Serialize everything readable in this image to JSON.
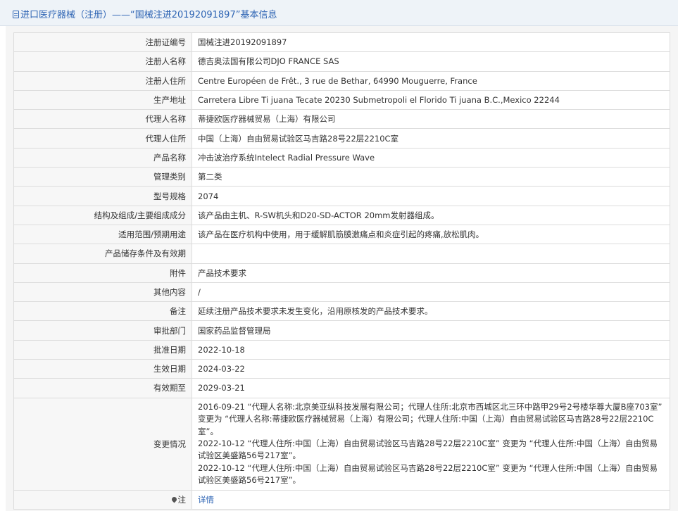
{
  "header": {
    "title": "进口医疗器械（注册）——“国械注进20192091897”基本信息"
  },
  "rows": [
    {
      "label": "注册证编号",
      "value": "国械注进20192091897"
    },
    {
      "label": "注册人名称",
      "value": "德吉奥法国有限公司DJO FRANCE SAS"
    },
    {
      "label": "注册人住所",
      "value": "Centre Européen de Frêt., 3 rue de Bethar, 64990 Mouguerre, France"
    },
    {
      "label": "生产地址",
      "value": "Carretera Libre Ti juana Tecate 20230 Submetropoli el Florido Ti juana B.C.,Mexico 22244"
    },
    {
      "label": "代理人名称",
      "value": "蒂捷欧医疗器械贸易（上海）有限公司"
    },
    {
      "label": "代理人住所",
      "value": "中国（上海）自由贸易试验区马吉路28号22层2210C室"
    },
    {
      "label": "产品名称",
      "value": "冲击波治疗系统Intelect Radial Pressure Wave"
    },
    {
      "label": "管理类别",
      "value": "第二类"
    },
    {
      "label": "型号规格",
      "value": "2074"
    },
    {
      "label": "结构及组成/主要组成成分",
      "value": "该产品由主机、R-SW机头和D20-SD-ACTOR 20mm发射器组成。"
    },
    {
      "label": "适用范围/预期用途",
      "value": "该产品在医疗机构中使用，用于缓解肌筋膜激痛点和炎症引起的疼痛,放松肌肉。"
    },
    {
      "label": "产品储存条件及有效期",
      "value": ""
    },
    {
      "label": "附件",
      "value": "产品技术要求"
    },
    {
      "label": "其他内容",
      "value": "/"
    },
    {
      "label": "备注",
      "value": "延续注册产品技术要求未发生变化，沿用原核发的产品技术要求。"
    },
    {
      "label": "审批部门",
      "value": "国家药品监督管理局"
    },
    {
      "label": "批准日期",
      "value": "2022-10-18"
    },
    {
      "label": "生效日期",
      "value": "2024-03-22"
    },
    {
      "label": "有效期至",
      "value": "2029-03-21"
    }
  ],
  "changes": {
    "label": "变更情况",
    "entries": [
      "2016-09-21 “代理人名称:北京美亚纵科技发展有限公司；代理人住所:北京市西城区北三环中路甲29号2号楼华尊大厦B座703室” 变更为 “代理人名称:蒂捷欧医疗器械贸易（上海）有限公司；代理人住所:中国（上海）自由贸易试验区马吉路28号22层2210C室”。",
      "2022-10-12 “代理人住所:中国（上海）自由贸易试验区马吉路28号22层2210C室” 变更为 “代理人住所:中国（上海）自由贸易试验区美盛路56号217室”。",
      "2022-10-12 “代理人住所:中国（上海）自由贸易试验区马吉路28号22层2210C室” 变更为 “代理人住所:中国（上海）自由贸易试验区美盛路56号217室”。"
    ]
  },
  "note": {
    "label": "注",
    "link": "详情",
    "icon": "location-pin-icon"
  }
}
